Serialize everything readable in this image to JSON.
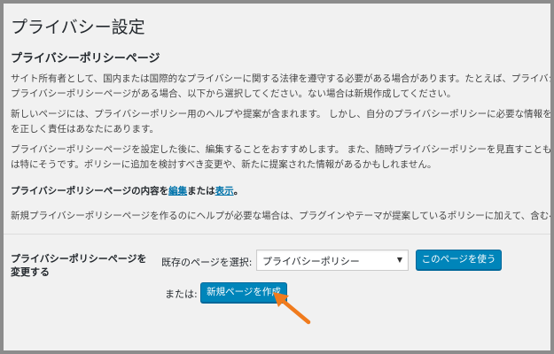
{
  "page": {
    "title": "プライバシー設定"
  },
  "section": {
    "title": "プライバシーポリシーページ",
    "paragraphs": [
      "サイト所有者として、国内または国際的なプライバシーに関する法律を遵守する必要がある場合があります。たとえば、プライバシーポ",
      "プライバシーポリシーページがある場合、以下から選択してください。ない場合は新規作成してください。",
      "新しいページには、プライバシーポリシー用のヘルプや提案が含まれます。 しかし、自分のプライバシーポリシーに必要な情報を提供し",
      "を正しく責任はあなたにあります。",
      "プライバシーポリシーページを設定した後に、編集することをおすすめします。 また、随時プライバシーポリシーを見直すこともおすす",
      "は特にそうです。ポリシーに追加を検討すべき変更や、新たに提案された情報があるかもしれません。",
      "新規プライバシーポリシーページを作るのにヘルプが必要な場合は、プラグインやテーマが提案しているポリシーに加えて、含むべき内"
    ],
    "content_line": {
      "prefix": "プライバシーポリシーページの内容を",
      "edit_link": "編集",
      "middle": "または",
      "view_link": "表示",
      "suffix": "。"
    }
  },
  "form": {
    "label": "プライバシーポリシーページを変更する",
    "select_label": "既存のページを選択:",
    "select_value": "プライバシーポリシー",
    "use_button": "このページを使う",
    "or_label": "または:",
    "create_button": "新規ページを作成"
  },
  "colors": {
    "button": "#0085ba",
    "link": "#0073aa",
    "arrow": "#f07b1d",
    "background": "#f1f1f1"
  }
}
